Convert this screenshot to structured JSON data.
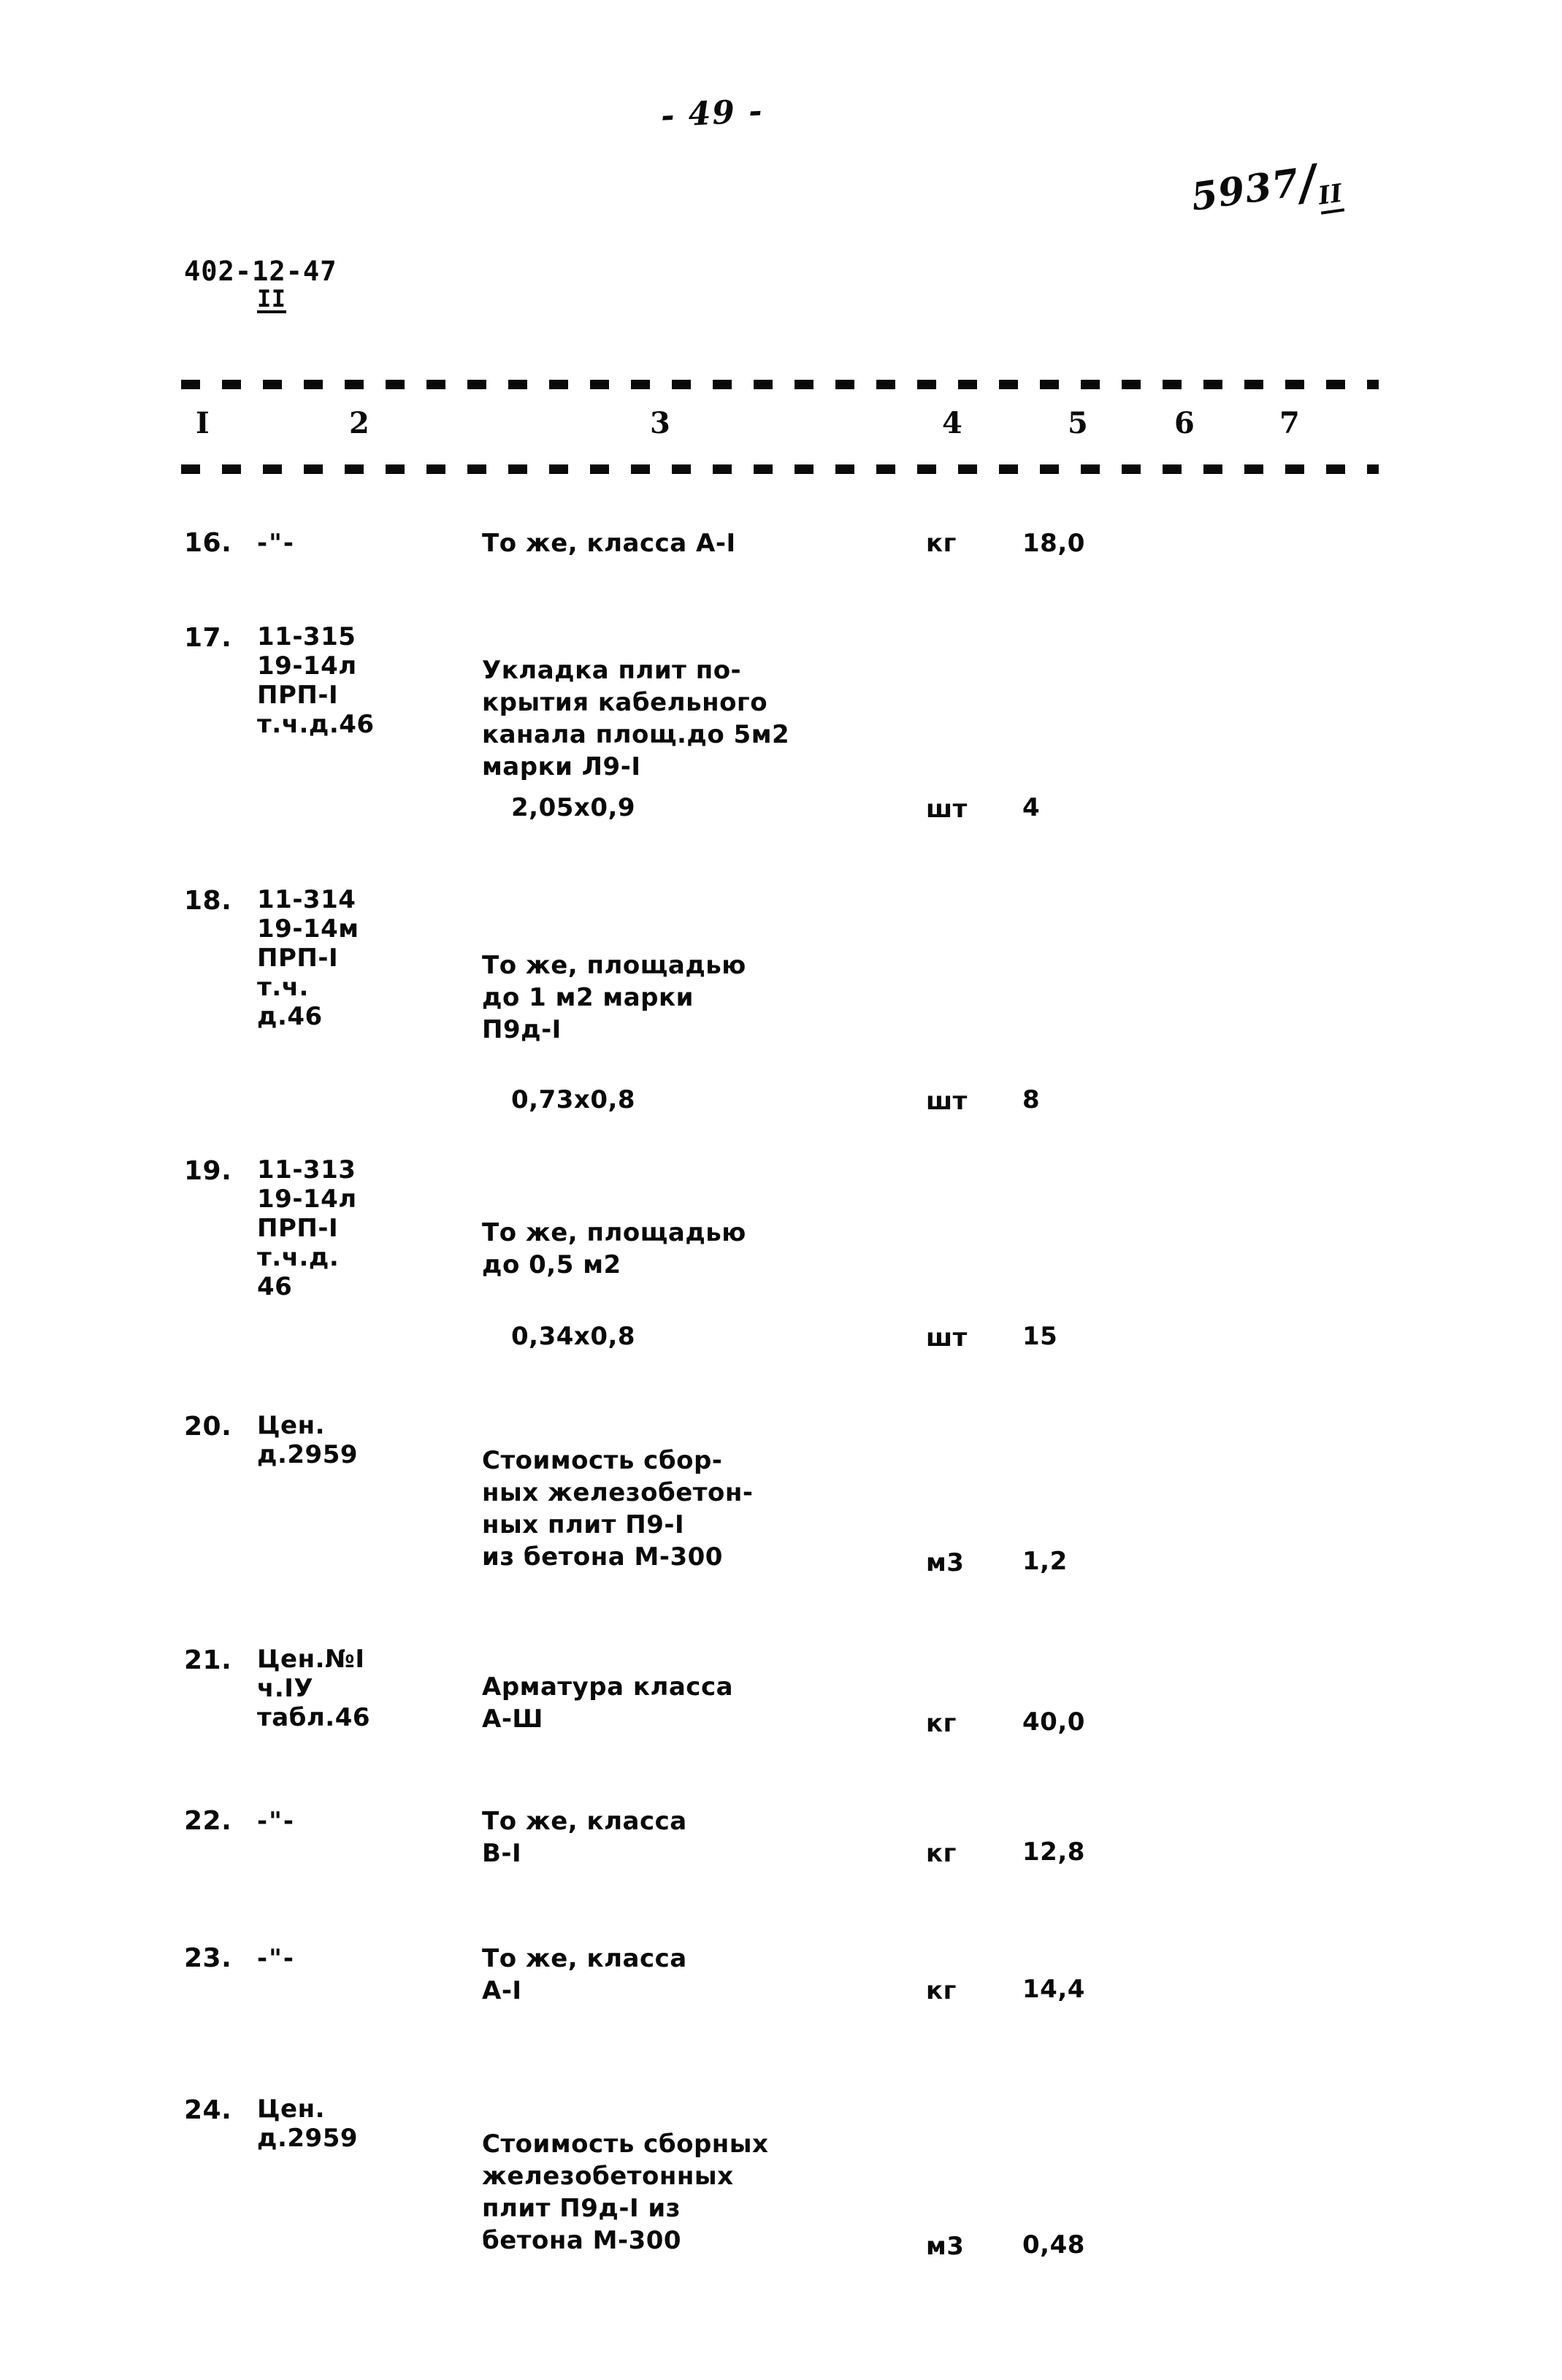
{
  "header": {
    "page_number": "- 49 -",
    "stamp_number": "5937",
    "stamp_sub": "II",
    "doc_code": "402-12-47",
    "doc_code_sub": "II"
  },
  "table": {
    "column_headers": [
      "I",
      "2",
      "3",
      "4",
      "5",
      "6",
      "7"
    ],
    "rows": [
      {
        "no": "16.",
        "code": "-\"-",
        "description": "То же, класса А-I",
        "unit": "кг",
        "qty": "18,0"
      },
      {
        "no": "17.",
        "code": "11-315\n19-14л\nПРП-I\nт.ч.д.46",
        "description": "Укладка плит по-\nкрытия кабельного\nканала площ.до 5м2\nмарки Л9-I",
        "dimension": "2,05х0,9",
        "unit": "шт",
        "qty": "4"
      },
      {
        "no": "18.",
        "code": "11-314\n19-14м\nПРП-I\nт.ч.\nд.46",
        "description": "То же, площадью\nдо 1 м2 марки\nП9д-I",
        "dimension": "0,73х0,8",
        "unit": "шт",
        "qty": "8"
      },
      {
        "no": "19.",
        "code": "11-313\n19-14л\nПРП-I\nт.ч.д.\n46",
        "description": "То же, площадью\nдо 0,5 м2",
        "dimension": "0,34х0,8",
        "unit": "шт",
        "qty": "15"
      },
      {
        "no": "20.",
        "code": "Цен.\nд.2959",
        "description": "Стоимость сбор-\nных железобетон-\nных плит П9-I\nиз бетона М-300",
        "unit": "м3",
        "qty": "1,2"
      },
      {
        "no": "21.",
        "code": "Цен.№I\nч.IУ\nтабл.46",
        "description": "Арматура класса\nА-Ш",
        "unit": "кг",
        "qty": "40,0"
      },
      {
        "no": "22.",
        "code": "-\"-",
        "description": "То же, класса\nВ-I",
        "unit": "кг",
        "qty": "12,8"
      },
      {
        "no": "23.",
        "code": "-\"-",
        "description": "То же, класса\nА-I",
        "unit": "кг",
        "qty": "14,4"
      },
      {
        "no": "24.",
        "code": "Цен.\nд.2959",
        "description": "Стоимость сборных\nжелезобетонных\nплит П9д-I из\nбетона М-300",
        "unit": "м3",
        "qty": "0,48"
      }
    ]
  }
}
